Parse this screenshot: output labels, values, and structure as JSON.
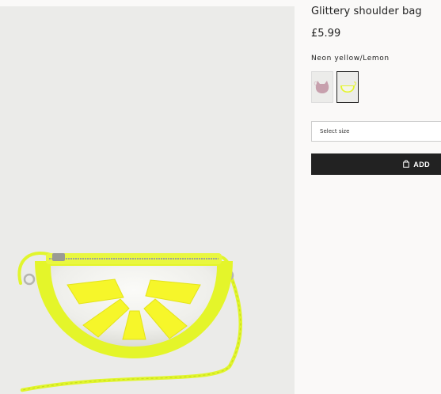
{
  "product": {
    "title": "Glittery shoulder bag",
    "price": "£5.99",
    "color_name": "Neon yellow/Lemon",
    "swatches": [
      {
        "name": "pink-cat",
        "selected": false
      },
      {
        "name": "neon-yellow-lemon",
        "selected": true
      }
    ],
    "size_select_label": "Select size",
    "add_label": "ADD"
  },
  "colors": {
    "page_background": "#faf9f8",
    "image_background": "#ebebe9",
    "button_background": "#222222",
    "neon_yellow": "#e4f52a",
    "lemon_segment": "#f6f62a"
  },
  "icons": {
    "add_button_icon": "shopping-bag-icon"
  }
}
